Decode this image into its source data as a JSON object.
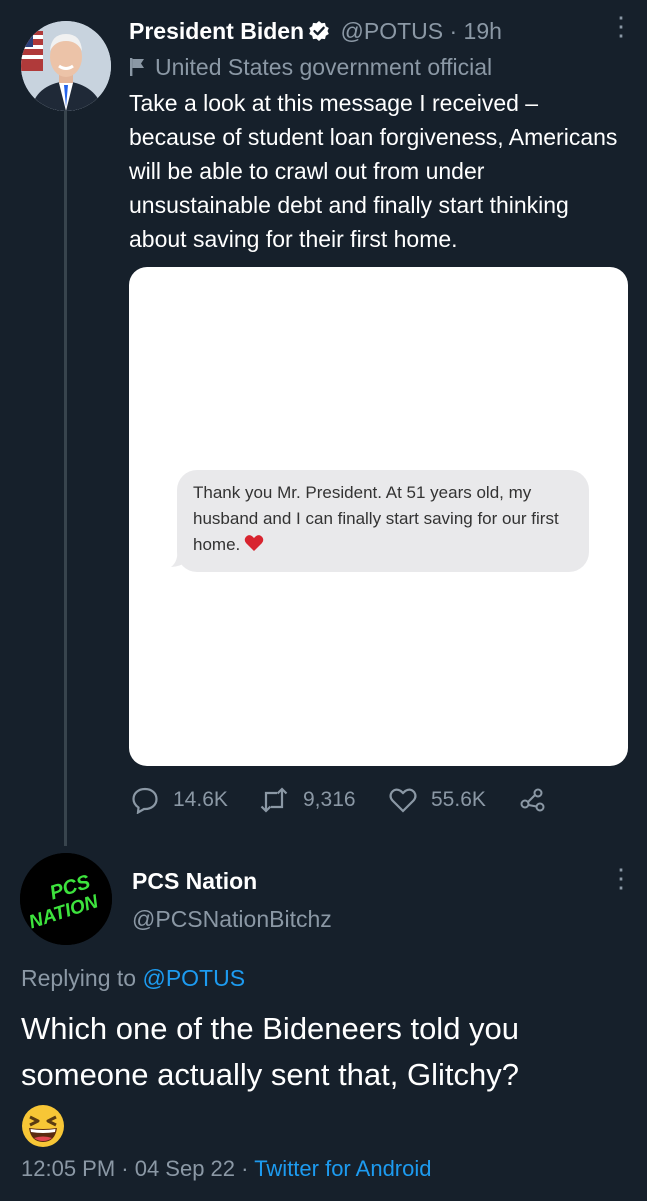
{
  "tweet1": {
    "display_name": "President Biden",
    "handle": "@POTUS",
    "time": "· 19h",
    "label": "United States government official",
    "text": "Take a look at this message I received – because of student loan forgiveness, Americans will be able to crawl out from under unsustainable debt and finally start thinking about saving for their first home.",
    "media_message": "Thank you Mr. President. At 51 years old, my husband and I can finally start saving for our first home.",
    "replies": "14.6K",
    "retweets": "9,316",
    "likes": "55.6K"
  },
  "tweet2": {
    "display_name": "PCS Nation",
    "handle": "@PCSNationBitchz",
    "avatar_text_1": "PCS",
    "avatar_text_2": "NATION",
    "replying_prefix": "Replying to",
    "replying_to": "@POTUS",
    "text": "Which one of the Bideneers told you someone actually sent that, Glitchy?",
    "timestamp": "12:05 PM · 04 Sep 22 · ",
    "source": "Twitter for Android"
  },
  "colors": {
    "background": "#16202b",
    "link": "#1d9bf0",
    "muted": "#8b98a5",
    "accent_green": "#3de33d"
  },
  "icons": [
    "verified-badge-icon",
    "more-options-icon",
    "government-flag-icon",
    "reply-icon",
    "retweet-icon",
    "like-icon",
    "share-icon",
    "red-heart-emoji",
    "grinning-squinting-face-emoji"
  ]
}
